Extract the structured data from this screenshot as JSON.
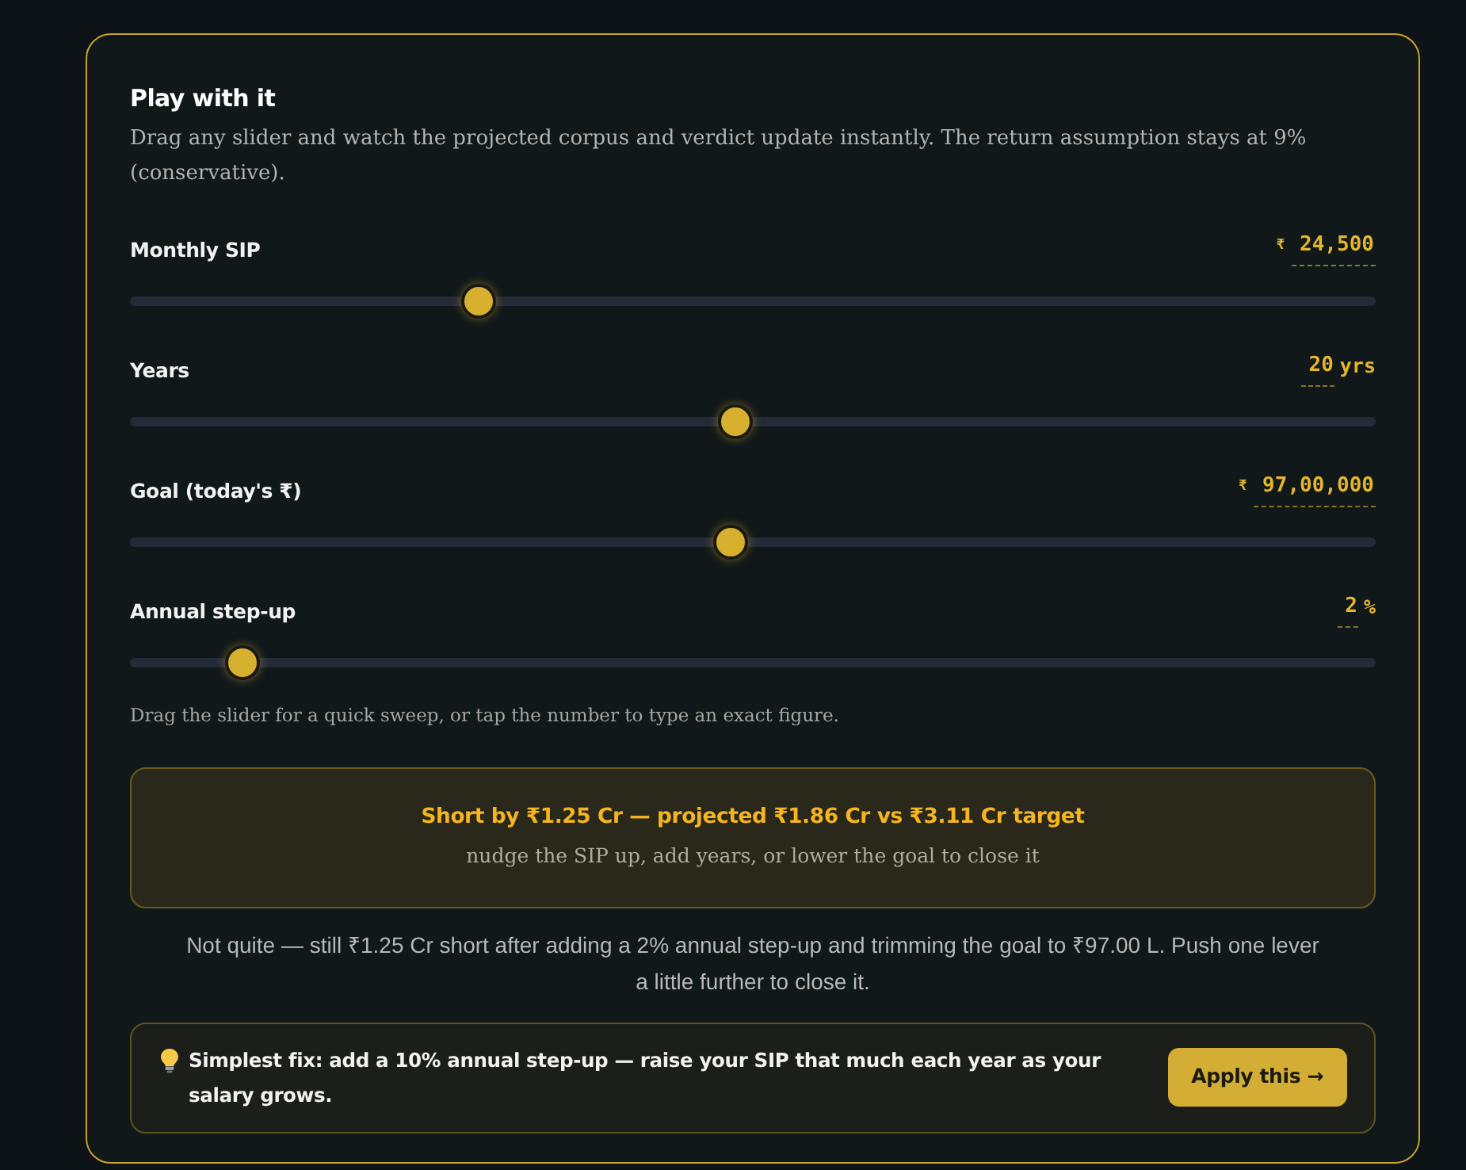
{
  "panel": {
    "title": "Play with it",
    "description": "Drag any slider and watch the projected corpus and verdict update instantly. The return assumption stays at 9% (conservative)."
  },
  "sliders": [
    {
      "label": "Monthly SIP",
      "prefix": "₹",
      "value": "24,500",
      "level": 0.28
    },
    {
      "label": "Years",
      "value": "20",
      "suffix": "yrs",
      "level": 0.486
    },
    {
      "label": "Goal (today's ₹)",
      "prefix": "₹",
      "value": "97,00,000",
      "level": 0.482
    },
    {
      "label": "Annual step-up",
      "value": "2",
      "suffix": "%",
      "level": 0.09
    }
  ],
  "hint": "Drag the slider for a quick sweep, or tap the number to type an exact figure.",
  "verdict": {
    "title": "Short by ₹1.25 Cr — projected ₹1.86 Cr vs ₹3.11 Cr target",
    "subtitle": "nudge the SIP up, add years, or lower the goal to close it"
  },
  "summary": "Not quite — still ₹1.25 Cr short after adding a 2% annual step-up and trimming the goal to ₹97.00 L. Push one lever a little further to close it.",
  "fix": {
    "text": "Simplest fix: add a 10% annual step-up — raise your SIP that much each year as your salary grows.",
    "button": "Apply this →"
  }
}
